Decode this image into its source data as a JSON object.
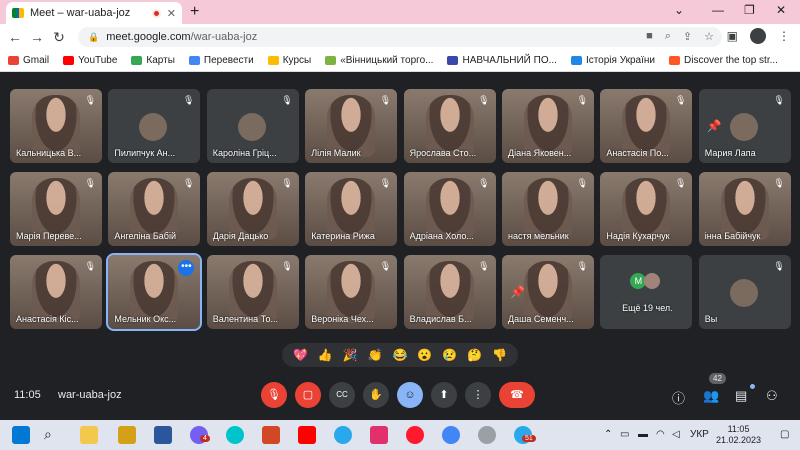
{
  "browser": {
    "tab_title": "Meet – war-uaba-joz",
    "url_host": "meet.google.com",
    "url_path": "/war-uaba-joz"
  },
  "bookmarks": [
    {
      "label": "Gmail",
      "color": "#ea4335"
    },
    {
      "label": "YouTube",
      "color": "#ff0000"
    },
    {
      "label": "Карты",
      "color": "#34a853"
    },
    {
      "label": "Перевести",
      "color": "#4285f4"
    },
    {
      "label": "Курсы",
      "color": "#fbbc04"
    },
    {
      "label": "«Вінницький торго...",
      "color": "#7cb342"
    },
    {
      "label": "НАВЧАЛЬНИЙ ПО...",
      "color": "#3949ab"
    },
    {
      "label": "Історія України",
      "color": "#1e88e5"
    },
    {
      "label": "Discover the top str...",
      "color": "#ff5722"
    }
  ],
  "participants": [
    {
      "name": "Кальницька В...",
      "type": "video"
    },
    {
      "name": "Пилипчук Ан...",
      "type": "avatar"
    },
    {
      "name": "Кароліна Гріц...",
      "type": "avatar"
    },
    {
      "name": "Лілія Малик",
      "type": "video"
    },
    {
      "name": "Ярослава Сто...",
      "type": "video"
    },
    {
      "name": "Діана Яковен...",
      "type": "video"
    },
    {
      "name": "Анастасія По...",
      "type": "video"
    },
    {
      "name": "Мария Лапа",
      "type": "avatar-pin"
    },
    {
      "name": "Марія Переве...",
      "type": "video"
    },
    {
      "name": "Ангеліна Бабій",
      "type": "video"
    },
    {
      "name": "Дарія Дацько",
      "type": "video"
    },
    {
      "name": "Катерина Рижа",
      "type": "video"
    },
    {
      "name": "Адріана Холо...",
      "type": "video"
    },
    {
      "name": "настя мельник",
      "type": "video"
    },
    {
      "name": "Надія Кухарчук",
      "type": "video"
    },
    {
      "name": "інна Бабійчук",
      "type": "video"
    },
    {
      "name": "Анастасія Кіс...",
      "type": "video"
    },
    {
      "name": "Мельник Окс...",
      "type": "video-active"
    },
    {
      "name": "Валентина То...",
      "type": "video"
    },
    {
      "name": "Вероніка Чех...",
      "type": "video"
    },
    {
      "name": "Владислав Б...",
      "type": "video"
    },
    {
      "name": "Даша Семенч...",
      "type": "video-pin"
    },
    {
      "name": "Ещё 19 чел.",
      "type": "more"
    },
    {
      "name": "Вы",
      "type": "self"
    }
  ],
  "more_badge_letter": "M",
  "reactions": [
    "💖",
    "👍",
    "🎉",
    "👏",
    "😂",
    "😮",
    "😢",
    "🤔",
    "👎"
  ],
  "meeting": {
    "time": "11:05",
    "code": "war-uaba-joz",
    "people_count": "42"
  },
  "taskbar": {
    "lang": "УКР",
    "time": "11:05",
    "date": "21.02.2023",
    "viber_badge": "4",
    "telegram_badge": "51"
  }
}
